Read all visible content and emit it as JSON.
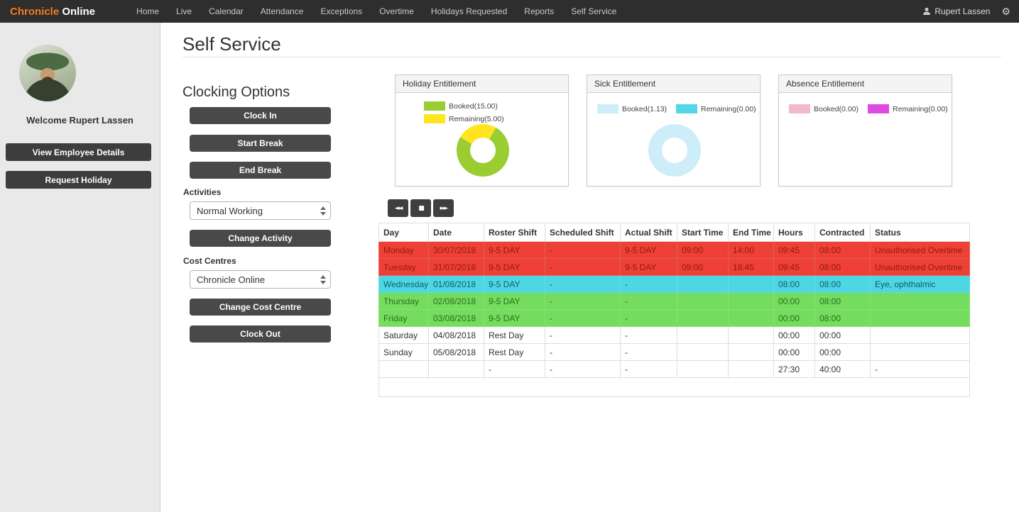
{
  "nav": {
    "brand_accent": "Chronicle",
    "brand_rest": " Online",
    "items": [
      "Home",
      "Live",
      "Calendar",
      "Attendance",
      "Exceptions",
      "Overtime",
      "Holidays Requested",
      "Reports",
      "Self Service"
    ],
    "user": "Rupert Lassen",
    "gear_glyph": "⚙"
  },
  "sidebar": {
    "welcome": "Welcome Rupert Lassen",
    "view_employee_details": "View Employee Details",
    "request_holiday": "Request Holiday"
  },
  "page": {
    "title": "Self Service"
  },
  "clocking": {
    "heading": "Clocking Options",
    "clock_in": "Clock In",
    "start_break": "Start Break",
    "end_break": "End Break",
    "activities_label": "Activities",
    "activity_selected": "Normal Working",
    "change_activity": "Change Activity",
    "cost_centres_label": "Cost Centres",
    "cost_centre_selected": "Chronicle Online",
    "change_cost_centre": "Change Cost Centre",
    "clock_out": "Clock Out"
  },
  "toolbar": {
    "buttons": [
      {
        "name": "fast-backward",
        "glyph": "◄◄"
      },
      {
        "name": "stop",
        "glyph": "■"
      },
      {
        "name": "fast-forward",
        "glyph": "►►"
      }
    ]
  },
  "chart_data": [
    {
      "type": "pie",
      "title": "Holiday Entitlement",
      "legend_layout": "stacked",
      "slices": [
        {
          "label": "Booked",
          "value": 15.0,
          "legend": "Booked(15.00)",
          "color": "#9acd32"
        },
        {
          "label": "Remaining",
          "value": 5.0,
          "legend": "Remaining(5.00)",
          "color": "#ffe41e"
        }
      ]
    },
    {
      "type": "pie",
      "title": "Sick Entitlement",
      "legend_layout": "row",
      "slices": [
        {
          "label": "Booked",
          "value": 1.13,
          "legend": "Booked(1.13)",
          "color": "#cdeef8"
        },
        {
          "label": "Remaining",
          "value": 0.0,
          "legend": "Remaining(0.00)",
          "color": "#55d6e8"
        }
      ]
    },
    {
      "type": "pie",
      "title": "Absence Entitlement",
      "legend_layout": "row",
      "slices": [
        {
          "label": "Booked",
          "value": 0.0,
          "legend": "Booked(0.00)",
          "color": "#f2b9c9"
        },
        {
          "label": "Remaining",
          "value": 0.0,
          "legend": "Remaining(0.00)",
          "color": "#e04ae0"
        }
      ]
    }
  ],
  "table": {
    "headers": [
      "Day",
      "Date",
      "Roster Shift",
      "Scheduled Shift",
      "Actual Shift",
      "Start Time",
      "End Time",
      "Hours",
      "Contracted",
      "Status"
    ],
    "rows": [
      {
        "highlight": "danger",
        "cells": [
          "Monday",
          "30/07/2018",
          "9-5 DAY",
          "-",
          "9-5 DAY",
          "09:00",
          "14:00",
          "09:45",
          "08:00",
          "Unauthorised Overtime"
        ]
      },
      {
        "highlight": "danger",
        "cells": [
          "Tuesday",
          "31/07/2018",
          "9-5 DAY",
          "-",
          "9-5 DAY",
          "09:00",
          "18:45",
          "09:45",
          "08:00",
          "Unauthorised Overtime"
        ]
      },
      {
        "highlight": "info",
        "cells": [
          "Wednesday",
          "01/08/2018",
          "9-5 DAY",
          "-",
          "-",
          "",
          "",
          "08:00",
          "08:00",
          "Eye, ophthalmic"
        ]
      },
      {
        "highlight": "success",
        "cells": [
          "Thursday",
          "02/08/2018",
          "9-5 DAY",
          "-",
          "-",
          "",
          "",
          "00:00",
          "08:00",
          ""
        ]
      },
      {
        "highlight": "success",
        "cells": [
          "Friday",
          "03/08/2018",
          "9-5 DAY",
          "-",
          "-",
          "",
          "",
          "00:00",
          "08:00",
          ""
        ]
      },
      {
        "highlight": "",
        "cells": [
          "Saturday",
          "04/08/2018",
          "Rest Day",
          "-",
          "-",
          "",
          "",
          "00:00",
          "00:00",
          ""
        ]
      },
      {
        "highlight": "",
        "cells": [
          "Sunday",
          "05/08/2018",
          "Rest Day",
          "-",
          "-",
          "",
          "",
          "00:00",
          "00:00",
          ""
        ]
      },
      {
        "highlight": "",
        "cells": [
          "",
          "",
          "-",
          "-",
          "-",
          "",
          "",
          "27:30",
          "40:00",
          "-"
        ]
      }
    ]
  },
  "colors": {
    "brand_orange": "#f47b20",
    "row_danger": "#ee4036",
    "row_danger_text": "#8e1b15",
    "row_info": "#4fd6e3",
    "row_info_text": "#0c606c",
    "row_success": "#74dc5e",
    "row_success_text": "#2c6e22"
  }
}
